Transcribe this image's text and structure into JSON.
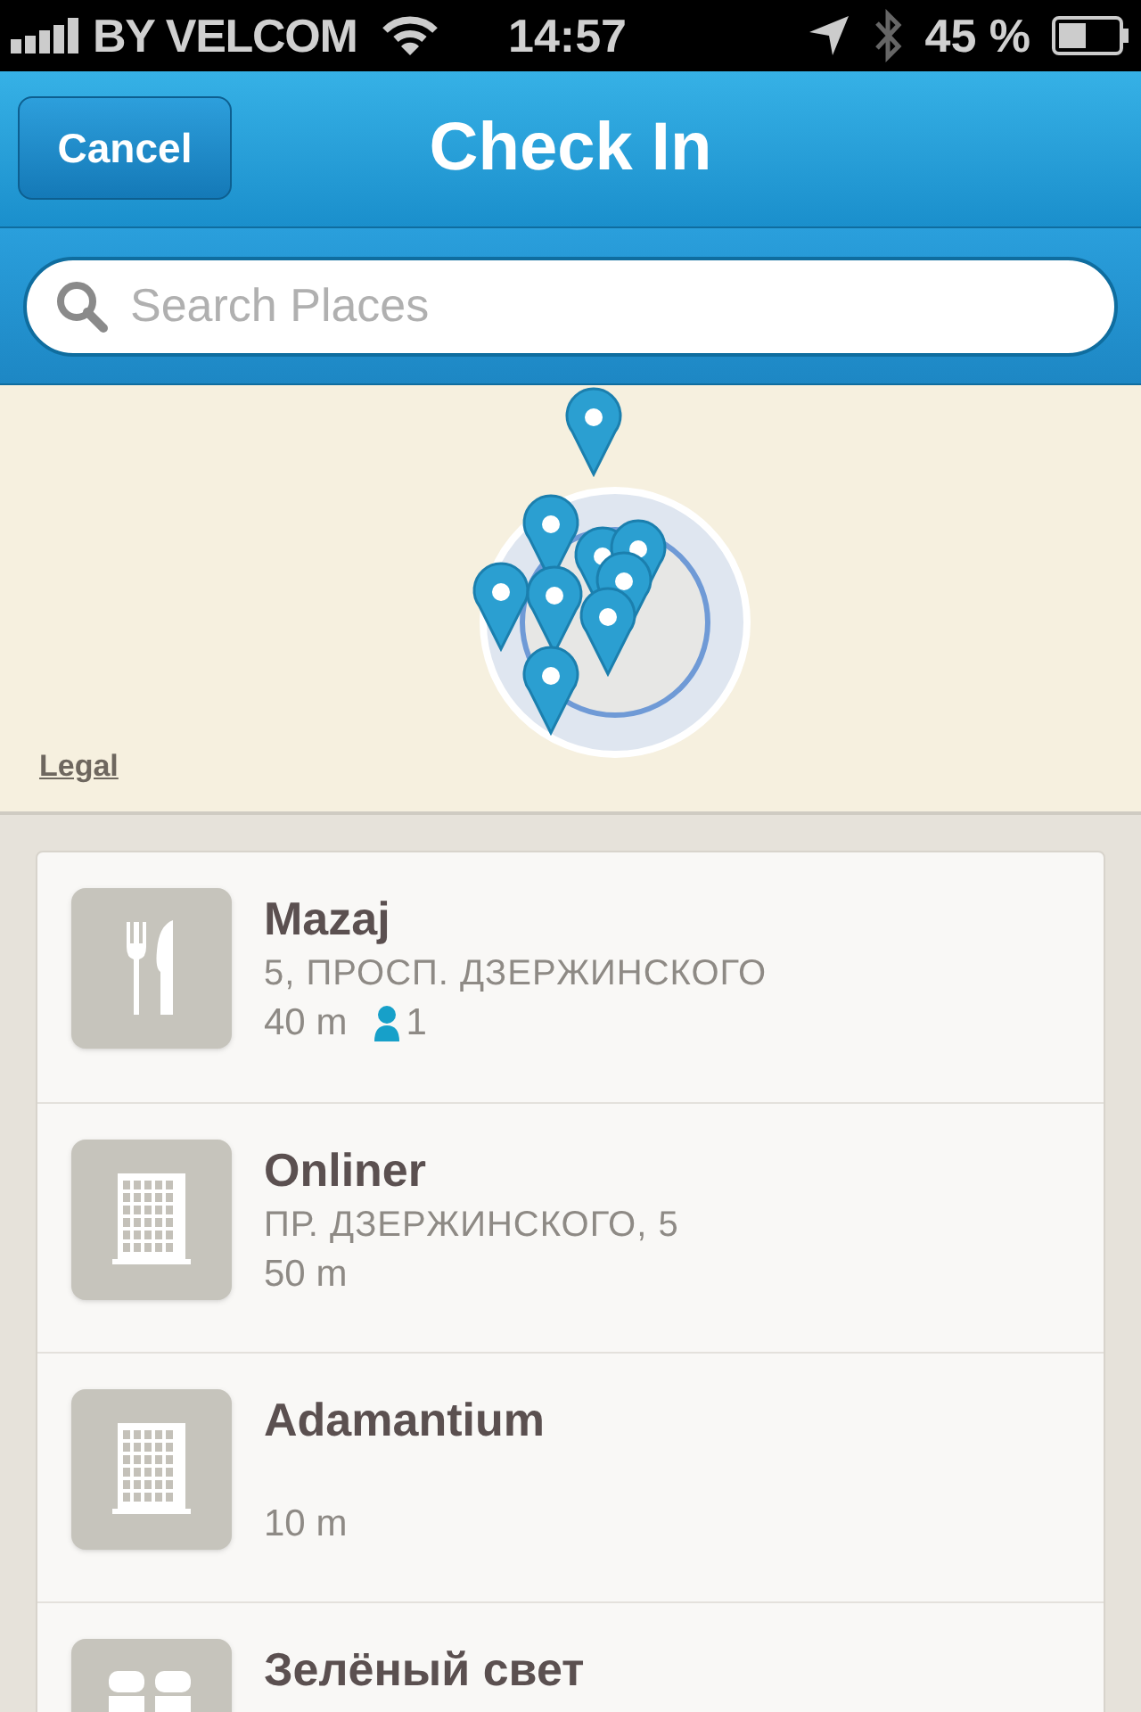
{
  "status_bar": {
    "carrier": "BY VELCOM",
    "time": "14:57",
    "battery": "45 %"
  },
  "nav_bar": {
    "cancel": "Cancel",
    "title": "Check In"
  },
  "search": {
    "placeholder": "Search Places"
  },
  "map": {
    "legal": "Legal"
  },
  "places": [
    {
      "kind": "food",
      "name": "Mazaj",
      "address": "5, ПРОСП. ДЗЕРЖИНСКОГО",
      "distance": "40 m",
      "checkins": "1"
    },
    {
      "kind": "building",
      "name": "Onliner",
      "address": "ПР. ДЗЕРЖИНСКОГО, 5",
      "distance": "50 m"
    },
    {
      "kind": "building",
      "name": "Adamantium",
      "distance": "10 m"
    },
    {
      "kind": "shop",
      "name": "Зелёный свет"
    }
  ]
}
